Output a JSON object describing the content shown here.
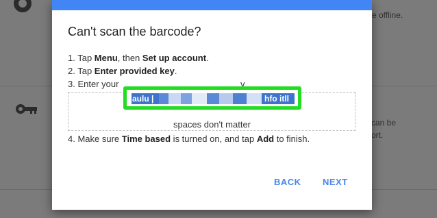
{
  "background": {
    "text_offline": "e offline.",
    "text_can_be": "can be",
    "text_ort": "ort.",
    "icons": [
      "app-icon",
      "key-icon"
    ]
  },
  "dialog": {
    "title": "Can't scan the barcode?",
    "steps": [
      {
        "num": "1. Tap ",
        "b1": "Menu",
        "mid": ", then ",
        "b2": "Set up account",
        "end": "."
      },
      {
        "num": "2. Tap ",
        "b1": "Enter provided key",
        "end": "."
      },
      {
        "num": "3. Enter your",
        "tail": "y"
      },
      {
        "num": "4. Make sure ",
        "b1": "Time based",
        "mid": " is turned on, and tap ",
        "b2": "Add",
        "end": " to finish."
      }
    ],
    "key_start": "aulu |",
    "key_end": "hfo itll",
    "hint": "spaces don't matter",
    "back_label": "BACK",
    "next_label": "NEXT"
  },
  "colors": {
    "accent": "#4285f4",
    "highlight_border": "#22dd22",
    "selection": "#3f74cc"
  }
}
